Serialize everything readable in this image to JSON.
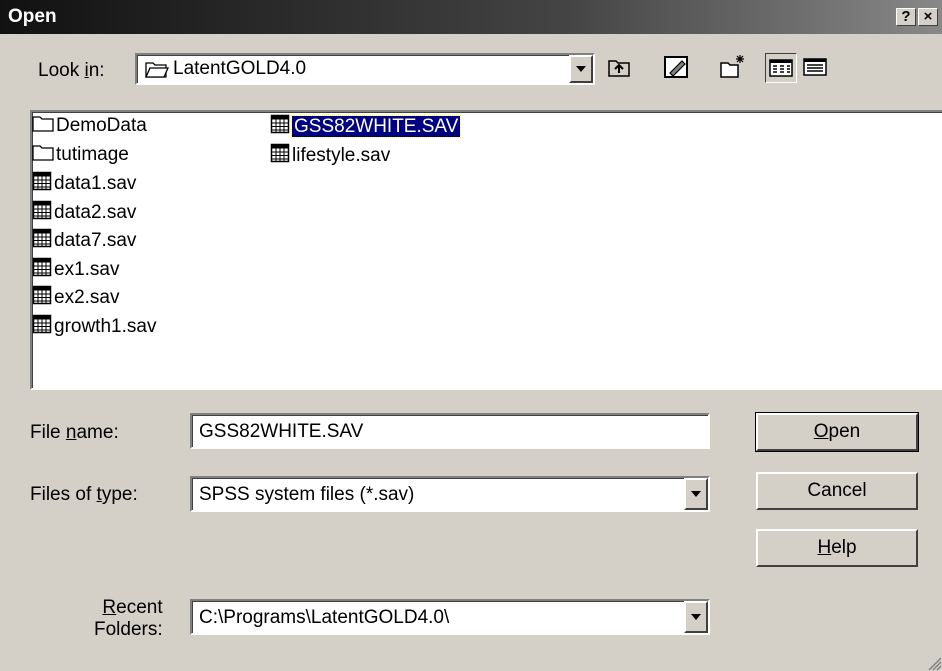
{
  "window": {
    "title": "Open",
    "help_button": "?",
    "close_button": "×"
  },
  "look_in": {
    "label_pre": "Look ",
    "label_accel": "i",
    "label_post": "n:",
    "value": "LatentGOLD4.0"
  },
  "toolbar": {
    "icons": [
      "up-one-level-icon",
      "desktop-icon",
      "new-folder-icon",
      "list-view-icon",
      "details-view-icon"
    ]
  },
  "file_list": {
    "column1": [
      {
        "name": "DemoData",
        "type": "folder"
      },
      {
        "name": "tutimage",
        "type": "folder"
      },
      {
        "name": "data1.sav",
        "type": "file"
      },
      {
        "name": "data2.sav",
        "type": "file"
      },
      {
        "name": "data7.sav",
        "type": "file"
      },
      {
        "name": "ex1.sav",
        "type": "file"
      },
      {
        "name": "ex2.sav",
        "type": "file"
      },
      {
        "name": "growth1.sav",
        "type": "file"
      }
    ],
    "column2": [
      {
        "name": "GSS82WHITE.SAV",
        "type": "file",
        "selected": true
      },
      {
        "name": "lifestyle.sav",
        "type": "file"
      }
    ]
  },
  "file_name": {
    "label_pre": "File ",
    "label_accel": "n",
    "label_post": "ame:",
    "value": "GSS82WHITE.SAV"
  },
  "files_of_type": {
    "label_pre": "Files of ",
    "label_accel": "t",
    "label_post": "ype:",
    "value": "SPSS system files (*.sav)"
  },
  "recent_folders": {
    "label_accel": "R",
    "label_line1_post": "ecent",
    "label_line2": "Folders:",
    "value": "C:\\Programs\\LatentGOLD4.0\\"
  },
  "buttons": {
    "open_accel": "O",
    "open_post": "pen",
    "cancel": "Cancel",
    "help_accel": "H",
    "help_post": "elp"
  },
  "colors": {
    "face": "#d4d0c8",
    "selection": "#000080"
  }
}
